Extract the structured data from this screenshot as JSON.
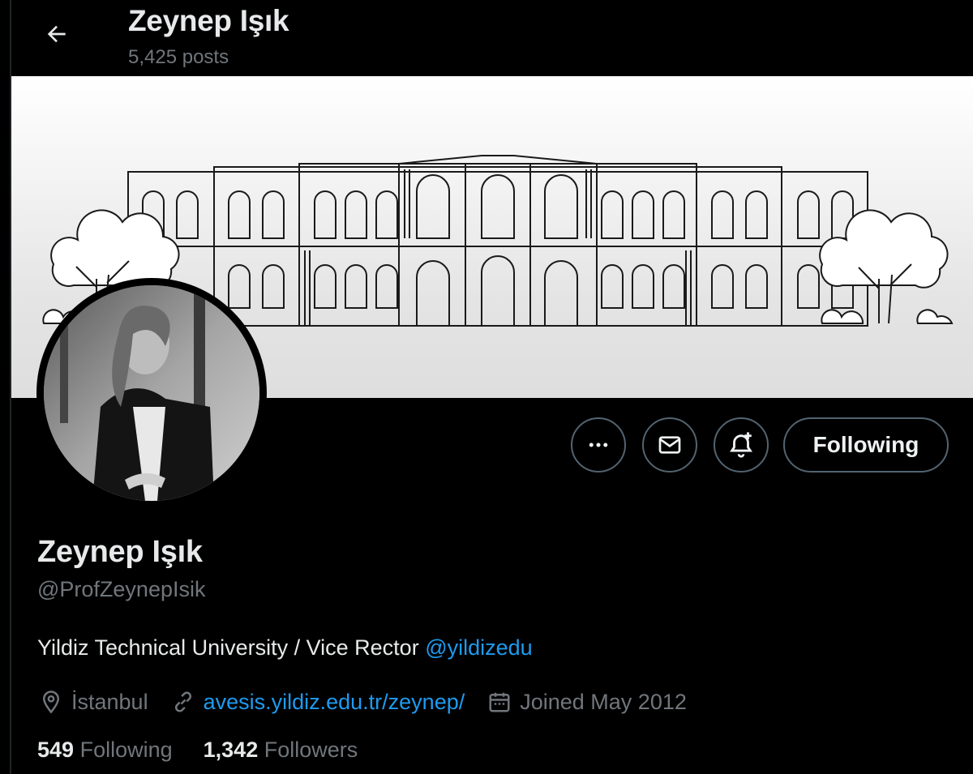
{
  "header": {
    "back_icon": "arrow-left-icon",
    "name": "Zeynep Işık",
    "posts_count": "5,425 posts"
  },
  "banner": {
    "description_icon": "university-building-illustration"
  },
  "actions": {
    "more_icon": "more-dots-icon",
    "message_icon": "envelope-icon",
    "notify_icon": "bell-plus-icon",
    "follow_label": "Following"
  },
  "profile": {
    "name": "Zeynep Işık",
    "handle": "@ProfZeynepIsik",
    "bio_text": "Yildiz Technical University / Vice Rector ",
    "bio_mention": "@yildizedu",
    "location": "İstanbul",
    "website": "avesis.yildiz.edu.tr/zeynep/",
    "joined": "Joined May 2012"
  },
  "stats": {
    "following_count": "549",
    "following_label": "Following",
    "followers_count": "1,342",
    "followers_label": "Followers"
  },
  "colors": {
    "background": "#000000",
    "text_primary": "#e7e9ea",
    "text_secondary": "#71767b",
    "link": "#1d9bf0",
    "border": "#536471"
  }
}
